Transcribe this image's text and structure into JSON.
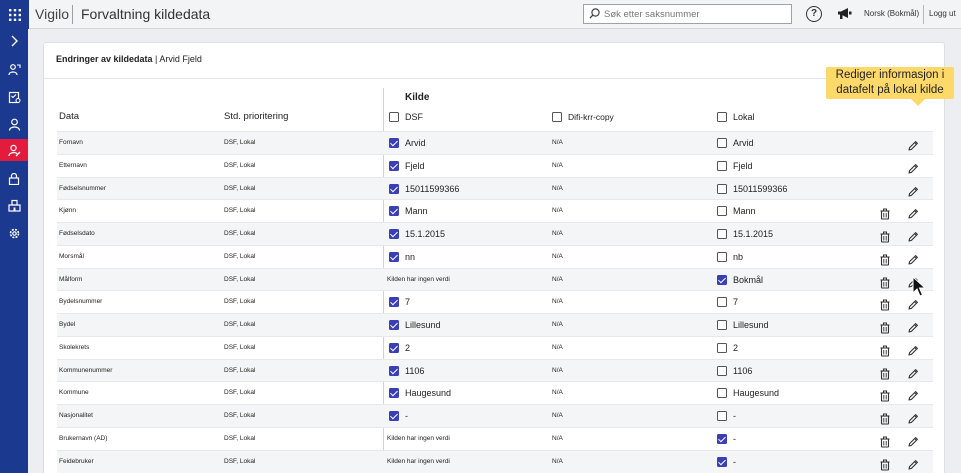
{
  "app": {
    "brand": "Vigilo",
    "title": "Forvaltning kildedata",
    "search_placeholder": "Søk etter saksnummer",
    "help_label": "?",
    "language": "Norsk (Bokmål)",
    "logout": "Logg ut"
  },
  "sidebar": {
    "items": [
      {
        "icon": "chevron-right-icon"
      },
      {
        "icon": "person-route-icon"
      },
      {
        "icon": "checklist-person-icon"
      },
      {
        "icon": "person-icon"
      },
      {
        "icon": "person-edit-icon",
        "active": true
      },
      {
        "icon": "lock-icon"
      },
      {
        "icon": "building-icon"
      },
      {
        "icon": "gear-icon"
      }
    ]
  },
  "breadcrumb": {
    "section": "Endringer av kildedata",
    "separator": " | ",
    "person": "Arvid Fjeld"
  },
  "table": {
    "header_data": "Data",
    "header_prio": "Std. prioritering",
    "header_kilde": "Kilde",
    "sources": [
      "DSF",
      "Difi-krr-copy",
      "Lokal"
    ],
    "rows": [
      {
        "name": "Fornavn",
        "prio": "DSF, Lokal",
        "dsf_checked": true,
        "dsf": "Arvid",
        "difi": "N/A",
        "lokal_checked": false,
        "lokal": "Arvid",
        "trash": false
      },
      {
        "name": "Etternavn",
        "prio": "DSF, Lokal",
        "dsf_checked": true,
        "dsf": "Fjeld",
        "difi": "N/A",
        "lokal_checked": false,
        "lokal": "Fjeld",
        "trash": false
      },
      {
        "name": "Fødselsnummer",
        "prio": "DSF, Lokal",
        "dsf_checked": true,
        "dsf": "15011599366",
        "difi": "N/A",
        "lokal_checked": false,
        "lokal": "15011599366",
        "trash": false
      },
      {
        "name": "Kjønn",
        "prio": "DSF, Lokal",
        "dsf_checked": true,
        "dsf": "Mann",
        "difi": "N/A",
        "lokal_checked": false,
        "lokal": "Mann",
        "trash": true
      },
      {
        "name": "Fødselsdato",
        "prio": "DSF, Lokal",
        "dsf_checked": true,
        "dsf": "15.1.2015",
        "difi": "N/A",
        "lokal_checked": false,
        "lokal": "15.1.2015",
        "trash": true
      },
      {
        "name": "Morsmål",
        "prio": "DSF, Lokal",
        "dsf_checked": true,
        "dsf": "nn",
        "difi": "N/A",
        "lokal_checked": false,
        "lokal": "nb",
        "trash": true
      },
      {
        "name": "Målform",
        "prio": "DSF, Lokal",
        "dsf_none": "Kilden har ingen verdi",
        "difi": "N/A",
        "lokal_checked": true,
        "lokal": "Bokmål",
        "trash": true
      },
      {
        "name": "Bydelsnummer",
        "prio": "DSF, Lokal",
        "dsf_checked": true,
        "dsf": "7",
        "difi": "N/A",
        "lokal_checked": false,
        "lokal": "7",
        "trash": true
      },
      {
        "name": "Bydel",
        "prio": "DSF, Lokal",
        "dsf_checked": true,
        "dsf": "Lillesund",
        "difi": "N/A",
        "lokal_checked": false,
        "lokal": "Lillesund",
        "trash": true
      },
      {
        "name": "Skolekrets",
        "prio": "DSF, Lokal",
        "dsf_checked": true,
        "dsf": "2",
        "difi": "N/A",
        "lokal_checked": false,
        "lokal": "2",
        "trash": true
      },
      {
        "name": "Kommunenummer",
        "prio": "DSF, Lokal",
        "dsf_checked": true,
        "dsf": "1106",
        "difi": "N/A",
        "lokal_checked": false,
        "lokal": "1106",
        "trash": true
      },
      {
        "name": "Kommune",
        "prio": "DSF, Lokal",
        "dsf_checked": true,
        "dsf": "Haugesund",
        "difi": "N/A",
        "lokal_checked": false,
        "lokal": "Haugesund",
        "trash": true
      },
      {
        "name": "Nasjonalitet",
        "prio": "DSF, Lokal",
        "dsf_checked": true,
        "dsf": "-",
        "difi": "N/A",
        "lokal_checked": false,
        "lokal": "-",
        "trash": true
      },
      {
        "name": "Brukernavn (AD)",
        "prio": "DSF, Lokal",
        "dsf_none": "Kilden har ingen verdi",
        "difi": "N/A",
        "lokal_checked": true,
        "lokal": "-",
        "trash": true
      },
      {
        "name": "Feidebruker",
        "prio": "DSF, Lokal",
        "dsf_none": "Kilden har ingen verdi",
        "difi": "N/A",
        "lokal_checked": true,
        "lokal": "-",
        "trash": true
      }
    ]
  },
  "tooltip": {
    "line1": "Rediger informasjon i",
    "line2": "datafelt på lokal kilde"
  },
  "colors": {
    "sidebar": "#1b3a8f",
    "active": "#e31b3c",
    "checkbox": "#3a3fb6",
    "tooltip": "#fdd96a"
  }
}
